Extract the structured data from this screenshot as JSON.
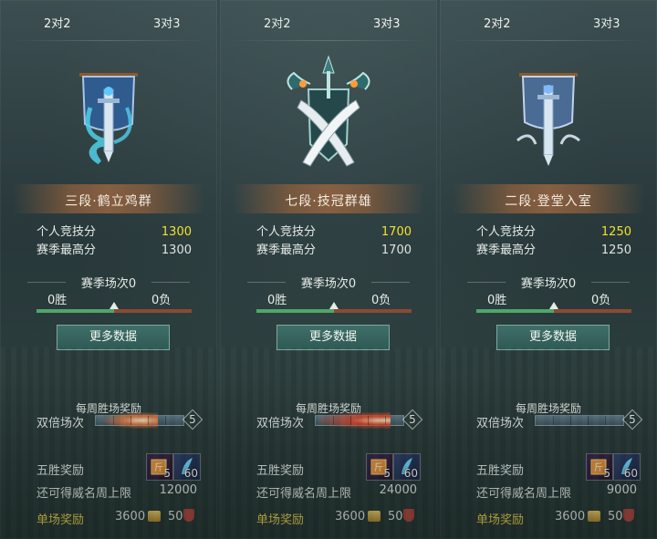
{
  "panels": [
    {
      "tabs": {
        "left": "2对2",
        "right": "3对3",
        "active": "left"
      },
      "emblem": "banner-sword-icon",
      "rank_title": "三段·鹤立鸡群",
      "stats": {
        "rating_label": "个人竞技分",
        "rating_value": "1300",
        "season_high_label": "赛季最高分",
        "season_high_value": "1300"
      },
      "season": {
        "title": "赛季场次0",
        "wins": "0胜",
        "losses": "0负",
        "win_ratio": 0.5
      },
      "more_button": "更多数据",
      "weekly": {
        "title": "每周胜场奖励",
        "double_label": "双倍场次",
        "double_count": "5",
        "progress": 0.6
      },
      "five_win": {
        "label": "五胜奖励",
        "items": [
          {
            "icon": "scroll-item-icon",
            "count": "5"
          },
          {
            "icon": "feather-item-icon",
            "count": "60"
          }
        ]
      },
      "remain": {
        "label": "还可得威名周上限",
        "value": "12000"
      },
      "single": {
        "label": "单场奖励",
        "coins": "3600",
        "shields": "50"
      }
    },
    {
      "tabs": {
        "left": "2对2",
        "right": "3对3",
        "active": "right"
      },
      "emblem": "crossed-swords-icon",
      "rank_title": "七段·技冠群雄",
      "stats": {
        "rating_label": "个人竞技分",
        "rating_value": "1700",
        "season_high_label": "赛季最高分",
        "season_high_value": "1700"
      },
      "season": {
        "title": "赛季场次0",
        "wins": "0胜",
        "losses": "0负",
        "win_ratio": 0.5
      },
      "more_button": "更多数据",
      "weekly": {
        "title": "每周胜场奖励",
        "double_label": "双倍场次",
        "double_count": "5",
        "progress": 0.85
      },
      "five_win": {
        "label": "五胜奖励",
        "items": [
          {
            "icon": "scroll-item-icon",
            "count": "5"
          },
          {
            "icon": "feather-item-icon",
            "count": "60"
          }
        ]
      },
      "remain": {
        "label": "还可得威名周上限",
        "value": "24000"
      },
      "single": {
        "label": "单场奖励",
        "coins": "3600",
        "shields": "50"
      }
    },
    {
      "tabs": {
        "left": "2对2",
        "right": "3对3",
        "active": "left"
      },
      "emblem": "banner-sword-icon",
      "rank_title": "二段·登堂入室",
      "stats": {
        "rating_label": "个人竞技分",
        "rating_value": "1250",
        "season_high_label": "赛季最高分",
        "season_high_value": "1250"
      },
      "season": {
        "title": "赛季场次0",
        "wins": "0胜",
        "losses": "0负",
        "win_ratio": 0.5
      },
      "more_button": "更多数据",
      "weekly": {
        "title": "每周胜场奖励",
        "double_label": "双倍场次",
        "double_count": "5",
        "progress": 0
      },
      "five_win": {
        "label": "五胜奖励",
        "items": [
          {
            "icon": "scroll-item-icon",
            "count": "5"
          },
          {
            "icon": "feather-item-icon",
            "count": "60"
          }
        ]
      },
      "remain": {
        "label": "还可得威名周上限",
        "value": "9000"
      },
      "single": {
        "label": "单场奖励",
        "coins": "3600",
        "shields": "50"
      }
    }
  ],
  "colors": {
    "highlight": "#f1e22c",
    "gold_label": "#f1d74a",
    "win_green": "#4fa66a",
    "loss_red": "#8b4a33",
    "button": "#2f5a55"
  }
}
